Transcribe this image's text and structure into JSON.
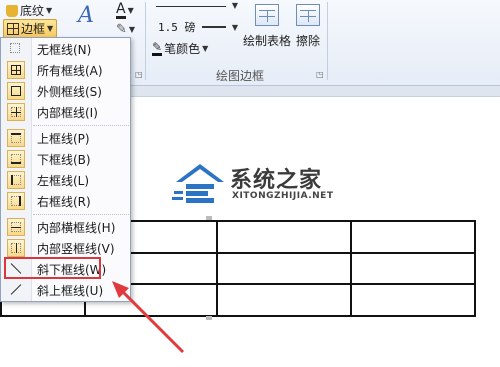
{
  "ribbon": {
    "shading_label": "底纹",
    "borders_label": "边框",
    "line_weight": "1.5 磅",
    "pen_color_label": "笔颜色",
    "draw_table_label": "绘制表格",
    "eraser_label": "擦除",
    "group_label": "绘图边框"
  },
  "menu": {
    "items": [
      {
        "label": "无框线(N)",
        "icon": "no-border-icon"
      },
      {
        "label": "所有框线(A)",
        "icon": "all-borders-icon"
      },
      {
        "label": "外侧框线(S)",
        "icon": "outside-borders-icon"
      },
      {
        "label": "内部框线(I)",
        "icon": "inside-borders-icon"
      },
      {
        "label": "上框线(P)",
        "icon": "top-border-icon"
      },
      {
        "label": "下框线(B)",
        "icon": "bottom-border-icon"
      },
      {
        "label": "左框线(L)",
        "icon": "left-border-icon"
      },
      {
        "label": "右框线(R)",
        "icon": "right-border-icon"
      },
      {
        "label": "内部横框线(H)",
        "icon": "inside-horizontal-border-icon"
      },
      {
        "label": "内部竖框线(V)",
        "icon": "inside-vertical-border-icon"
      },
      {
        "label": "斜下框线(W)",
        "icon": "diagonal-down-border-icon"
      },
      {
        "label": "斜上框线(U)",
        "icon": "diagonal-up-border-icon"
      }
    ]
  },
  "watermark": {
    "title": "系统之家",
    "subtitle": "XITONGZHIJIA.NET"
  },
  "colors": {
    "highlight_red": "#d9363e",
    "ribbon_bg": "#e6edf7",
    "active_button": "#f8c95e"
  }
}
